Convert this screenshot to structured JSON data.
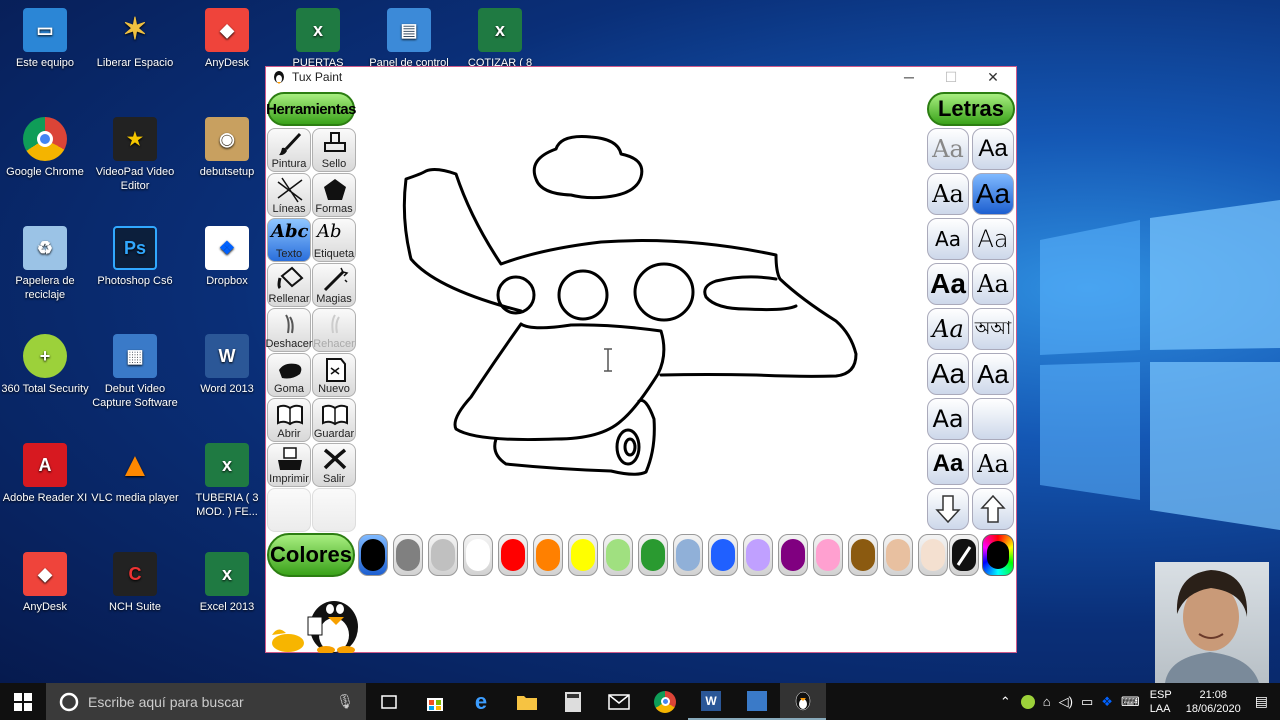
{
  "desktop_icons": [
    {
      "label": "Este equipo"
    },
    {
      "label": "Liberar Espacio"
    },
    {
      "label": "AnyDesk"
    },
    {
      "label": "PUERTAS PAIJAN-"
    },
    {
      "label": "Panel de control"
    },
    {
      "label": "COTIZAR ( 8"
    },
    {
      "label": "Google Chrome"
    },
    {
      "label": "VideoPad Video Editor"
    },
    {
      "label": "debutsetup"
    },
    {
      "label": "Papelera de reciclaje"
    },
    {
      "label": "Photoshop Cs6"
    },
    {
      "label": "Dropbox"
    },
    {
      "label": "360 Total Security"
    },
    {
      "label": "Debut Video Capture Software"
    },
    {
      "label": "Word 2013"
    },
    {
      "label": "Adobe Reader XI"
    },
    {
      "label": "VLC media player"
    },
    {
      "label": "TUBERIA ( 3 MOD. ) FE..."
    },
    {
      "label": "AnyDesk"
    },
    {
      "label": "NCH Suite"
    },
    {
      "label": "Excel 2013"
    }
  ],
  "window": {
    "title": "Tux Paint",
    "minimize": "─",
    "maximize": "☐",
    "close": "✕"
  },
  "tools_header": "Herramientas",
  "tools": [
    {
      "label": "Pintura"
    },
    {
      "label": "Sello"
    },
    {
      "label": "Líneas"
    },
    {
      "label": "Formas"
    },
    {
      "label": "Texto"
    },
    {
      "label": "Etiqueta"
    },
    {
      "label": "Rellenar"
    },
    {
      "label": "Magias"
    },
    {
      "label": "Deshacer"
    },
    {
      "label": "Rehacer"
    },
    {
      "label": "Goma"
    },
    {
      "label": "Nuevo"
    },
    {
      "label": "Abrir"
    },
    {
      "label": "Guardar"
    },
    {
      "label": "Imprimir"
    },
    {
      "label": "Salir"
    }
  ],
  "tool_icon_glyphs": {
    "texto": "Abc",
    "etiqueta": "Ab"
  },
  "letters_header": "Letras",
  "fonts": [
    "Aa",
    "Aa",
    "Aa",
    "Aa",
    "Aa",
    "Aa",
    "Aa",
    "Aa",
    "Aa",
    "অআ",
    "Aa",
    "Aa",
    "Aa",
    "",
    "Aa",
    "Aa"
  ],
  "colors_header": "Colores",
  "palette": [
    "#000000",
    "#808080",
    "#c0c0c0",
    "#ffffff",
    "#ff0000",
    "#ff8000",
    "#ffff00",
    "#a0e080",
    "#2a9a30",
    "#90b0d8",
    "#2060ff",
    "#c0a0ff",
    "#800080",
    "#ffa0d0",
    "#8b5a10",
    "#e8c0a0",
    "#f4e0d0"
  ],
  "accent": {
    "green": "#3aa21a",
    "blue": "#2a6fdc"
  },
  "taskbar": {
    "search_placeholder": "Escribe aquí para buscar",
    "lang1": "ESP",
    "lang2": "LAA",
    "time": "21:08",
    "date": "18/06/2020"
  }
}
